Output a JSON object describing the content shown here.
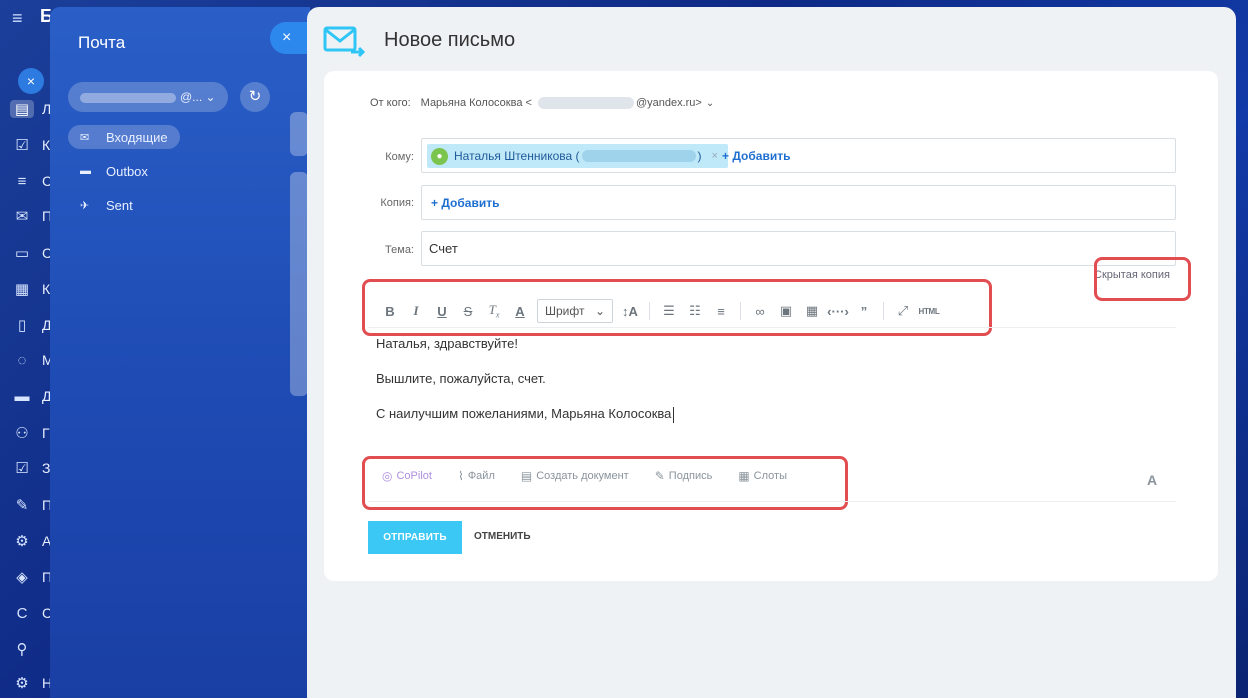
{
  "rail": {
    "header_letter": "Б",
    "items": [
      {
        "icon": "feed-icon",
        "glyph": "▤",
        "label": "Л"
      },
      {
        "icon": "tasks-icon",
        "glyph": "☑",
        "label": "К"
      },
      {
        "icon": "crm-icon",
        "glyph": "≡",
        "label": "С"
      },
      {
        "icon": "mail-icon",
        "glyph": "✉",
        "label": "П"
      },
      {
        "icon": "chat-icon",
        "glyph": "▭",
        "label": "С"
      },
      {
        "icon": "calendar-icon",
        "glyph": "▦",
        "label": "К"
      },
      {
        "icon": "docs-icon",
        "glyph": "▯",
        "label": "Д"
      },
      {
        "icon": "messenger-icon",
        "glyph": "◌",
        "label": "М"
      },
      {
        "icon": "drive-icon",
        "glyph": "▬",
        "label": "Д"
      },
      {
        "icon": "groups-icon",
        "glyph": "⚇",
        "label": "Г"
      },
      {
        "icon": "checklist-icon",
        "glyph": "☑",
        "label": "З"
      },
      {
        "icon": "sign-icon",
        "glyph": "✎",
        "label": "П"
      },
      {
        "icon": "automation-icon",
        "glyph": "⚙",
        "label": "А"
      },
      {
        "icon": "box-icon",
        "glyph": "◈",
        "label": "П"
      },
      {
        "icon": "copilot-rail-icon",
        "glyph": "C",
        "label": "С"
      },
      {
        "icon": "user-rail-icon",
        "glyph": "⚲",
        "label": ""
      },
      {
        "icon": "settings-icon",
        "glyph": "⚙",
        "label": "Н"
      }
    ]
  },
  "mail": {
    "title": "Почта",
    "account_suffix": "@...",
    "folders": [
      {
        "label": "Входящие",
        "icon": "inbox-icon",
        "active": true
      },
      {
        "label": "Outbox",
        "icon": "folder-icon",
        "active": false
      },
      {
        "label": "Sent",
        "icon": "sent-icon",
        "active": false
      }
    ]
  },
  "compose": {
    "title": "Новое письмо",
    "from_label": "От кого:",
    "from_name": "Марьяна Колосоква",
    "from_email_suffix": "@yandex.ru>",
    "to_label": "Кому:",
    "recipient_name": "Наталья Штенникова (",
    "recipient_tail": ")",
    "add_label": "+ Добавить",
    "cc_label": "Копия:",
    "subject_label": "Тема:",
    "subject_value": "Счет",
    "bcc_label": "Скрытая копия",
    "font_select": "Шрифт",
    "html_label": "HTML",
    "body_lines": [
      "Наталья, здравствуйте!",
      "Вышлите, пожалуйста, счет.",
      "С наилучшим пожеланиями, Марьяна Колосоква"
    ],
    "bottom_actions": {
      "copilot": "CoPilot",
      "file": "Файл",
      "create_doc": "Создать документ",
      "signature": "Подпись",
      "slots": "Слоты"
    },
    "format_toggle": "A",
    "send": "ОТПРАВИТЬ",
    "cancel": "ОТМЕНИТЬ"
  }
}
